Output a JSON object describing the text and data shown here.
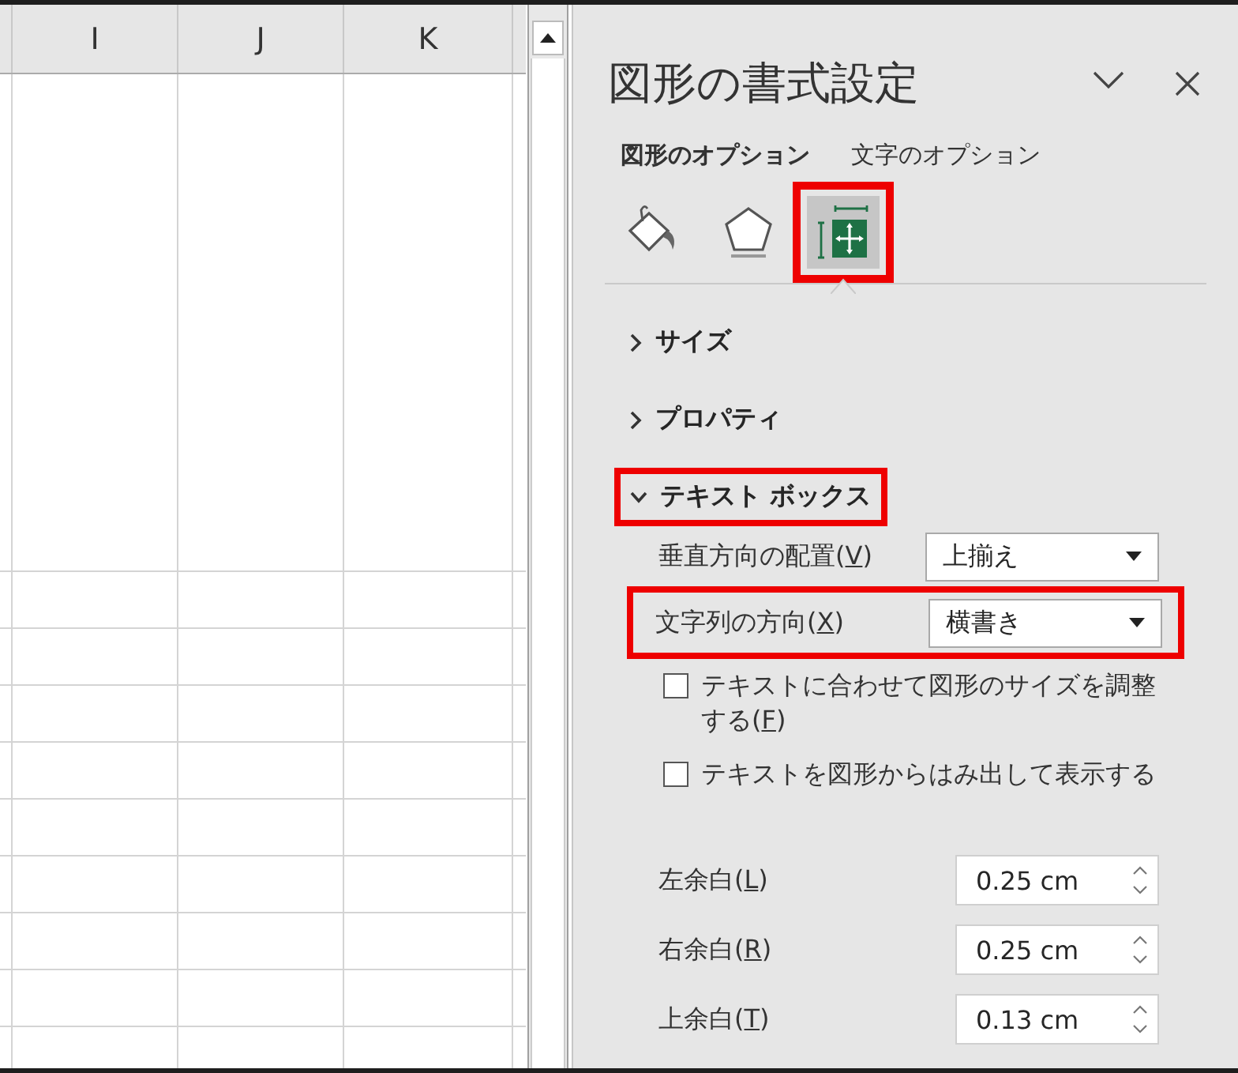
{
  "sheet": {
    "columns": [
      "I",
      "J",
      "K"
    ]
  },
  "pane": {
    "title": "図形の書式設定",
    "tabs": [
      {
        "label": "図形のオプション",
        "selected": true
      },
      {
        "label": "文字のオプション",
        "selected": false
      }
    ],
    "icon_tabs": [
      {
        "kind": "fill",
        "selected": false,
        "highlighted": false
      },
      {
        "kind": "shape",
        "selected": false,
        "highlighted": false
      },
      {
        "kind": "layout",
        "selected": true,
        "highlighted": true
      }
    ],
    "sections": [
      {
        "title": "サイズ",
        "expanded": false,
        "highlighted": false
      },
      {
        "title": "プロパティ",
        "expanded": false,
        "highlighted": false
      },
      {
        "title": "テキスト ボックス",
        "expanded": true,
        "highlighted": true,
        "controls": [
          {
            "kind": "select",
            "label": "垂直方向の配置(",
            "access_key": "V",
            "label_end": ")",
            "value": "上揃え",
            "highlighted": false
          },
          {
            "kind": "select",
            "label": "文字列の方向(",
            "access_key": "X",
            "label_end": ")",
            "value": "横書き",
            "highlighted": true
          },
          {
            "kind": "checkbox",
            "label": "テキストに合わせて図形のサイズを調整する(",
            "access_key": "F",
            "label_end": ")",
            "checked": false
          },
          {
            "kind": "checkbox",
            "label": "テキストを図形からはみ出して表示する",
            "checked": false
          },
          {
            "kind": "spin",
            "label": "左余白(",
            "access_key": "L",
            "label_end": ")",
            "value": "0.25 cm"
          },
          {
            "kind": "spin",
            "label": "右余白(",
            "access_key": "R",
            "label_end": ")",
            "value": "0.25 cm"
          },
          {
            "kind": "spin",
            "label": "上余白(",
            "access_key": "T",
            "label_end": ")",
            "value": "0.13 cm"
          }
        ]
      }
    ]
  }
}
